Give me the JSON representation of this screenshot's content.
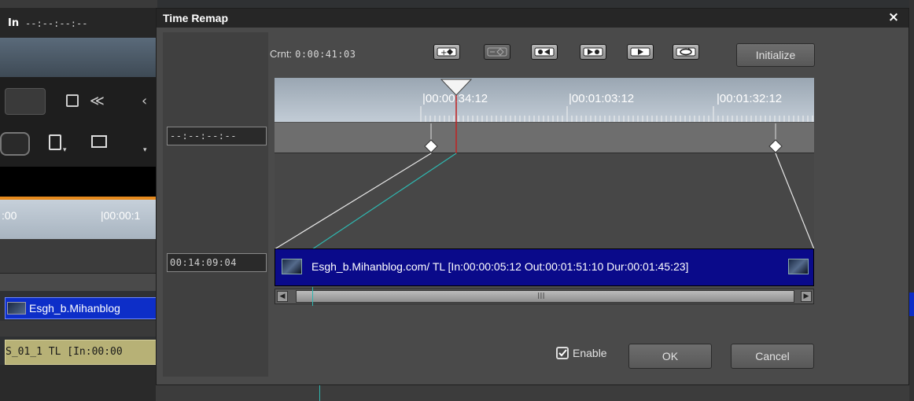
{
  "background": {
    "in_label": "In",
    "in_timecode": "--:--:--:--",
    "ruler_labels": [
      ":00",
      "|00:00:1"
    ],
    "clip_video": "Esgh_b.Mihanblog",
    "clip_audio": "S_01_1  TL [In:00:00"
  },
  "dialog": {
    "title": "Time Remap",
    "close_label": "×",
    "crnt_label": "Crnt:",
    "crnt_value": "0:00:41:03",
    "initialize_label": "Initialize",
    "source_timecode": "--:--:--:--",
    "clip_timecode": "00:14:09:04",
    "ruler_labels": [
      "|00:00:34:12",
      "|00:01:03:12",
      "|00:01:32:12"
    ],
    "clip_text": "Esgh_b.Mihanblog.com/  TL [In:00:00:05:12 Out:00:01:51:10 Dur:00:01:45:23]",
    "scroll_grip": "III",
    "enable_label": "Enable",
    "enable_checked": true,
    "ok_label": "OK",
    "cancel_label": "Cancel",
    "tool_icons": [
      "add-keyframe-icon",
      "delete-keyframe-icon",
      "prev-keyframe-icon",
      "next-keyframe-icon",
      "play-icon",
      "loop-icon"
    ]
  },
  "colors": {
    "playhead": "#c02020",
    "speed_line": "#2fb7b0",
    "clip_bar": "#0a0a8a"
  }
}
